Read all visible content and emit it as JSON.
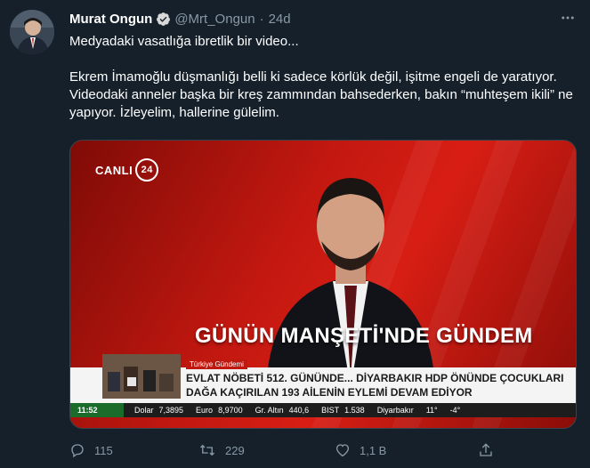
{
  "author": {
    "name": "Murat Ongun",
    "handle": "@Mrt_Ongun",
    "separator": "·",
    "time": "24d"
  },
  "tweet": {
    "line1": "Medyadaki vasatlığa ibretlik bir video...",
    "paragraph2": "Ekrem İmamoğlu düşmanlığı belli ki sadece körlük değil, işitme engeli de yaratıyor. Videodaki anneler başka bir kreş zammından bahsederken, bakın “muhteşem ikili” ne yapıyor. İzleyelim, hallerine gülelim."
  },
  "media": {
    "live_label": "CANLI",
    "channel_number": "24",
    "headline": "GÜNÜN MANŞETİ'NDE GÜNDEM",
    "ticker_tag": "Türkiye Gündemi",
    "ticker_line1": "EVLAT NÖBETİ 512. GÜNÜNDE... DİYARBAKIR HDP ÖNÜNDE ÇOCUKLARI",
    "ticker_line2": "DAĞA KAÇIRILAN 193 AİLENİN EYLEMİ DEVAM EDİYOR",
    "bottom": {
      "clock": "11:52",
      "dolar_label": "Dolar",
      "dolar_value": "7,3895",
      "euro_label": "Euro",
      "euro_value": "8,9700",
      "altin_label": "Gr. Altın",
      "altin_value": "440,6",
      "bist_label": "BIST",
      "bist_value": "1.538",
      "city": "Diyarbakır",
      "temp1": "11°",
      "temp2": "-4°"
    }
  },
  "actions": {
    "reply_count": "115",
    "retweet_count": "229",
    "like_count": "1,1 B"
  },
  "colors": {
    "background": "#15202b",
    "secondary_text": "#8899a6",
    "verified": "#1da1f2",
    "channel_red": "#c21810"
  },
  "icons": [
    "verified-badge-icon",
    "more-icon",
    "reply-icon",
    "retweet-icon",
    "like-icon",
    "share-icon"
  ]
}
